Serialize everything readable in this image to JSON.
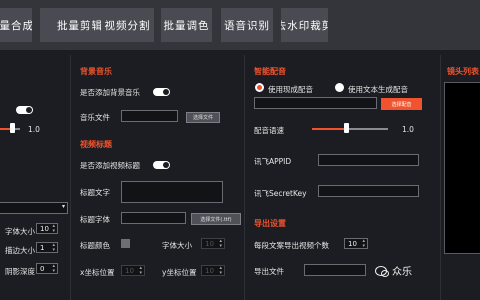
{
  "tabs": [
    "批量合成",
    "批量剪辑",
    "视频分割",
    "批量调色",
    "语音识别",
    "去水印裁剪"
  ],
  "left": {
    "slider_value": "1.0",
    "stepper_label_1": "字体大小",
    "stepper_value_1": "10",
    "stepper_label_2": "描边大小",
    "stepper_value_2": "1",
    "stepper_label_3": "阴影深度",
    "stepper_value_3": "0"
  },
  "music": {
    "section_title": "背景音乐",
    "add_bg_music_label": "是否添加背景音乐",
    "music_file_label": "音乐文件",
    "select_file_button": "选择文件"
  },
  "title": {
    "section_title": "视频标题",
    "add_title_label": "是否添加视频标题",
    "title_text_label": "标题文字",
    "title_font_label": "标题字体",
    "select_font_button": "选择文件(.ttf)",
    "title_color_label": "标题颜色",
    "font_size_label": "字体大小",
    "font_size_value": "10",
    "x_pos_label": "x坐标位置",
    "x_pos_value": "10",
    "y_pos_label": "y坐标位置",
    "y_pos_value": "10"
  },
  "dub": {
    "section_title": "智能配音",
    "use_existing_label": "使用现成配音",
    "use_generated_label": "使用文本生成配音",
    "select_dub_button": "选择配音",
    "speed_label": "配音语速",
    "speed_value": "1.0",
    "speed_fraction": 0.45,
    "appid_label": "讯飞APPID",
    "secret_label": "讯飞SecretKey"
  },
  "export": {
    "section_title": "导出设置",
    "count_label": "每段文案导出视频个数",
    "count_value": "10",
    "file_label": "导出文件"
  },
  "lens": {
    "section_title": "镜头列表"
  },
  "watermark": {
    "text": "众乐"
  },
  "colors": {
    "accent": "#f0532d",
    "bg": "#1c1d22",
    "tab": "#4a4b52"
  }
}
